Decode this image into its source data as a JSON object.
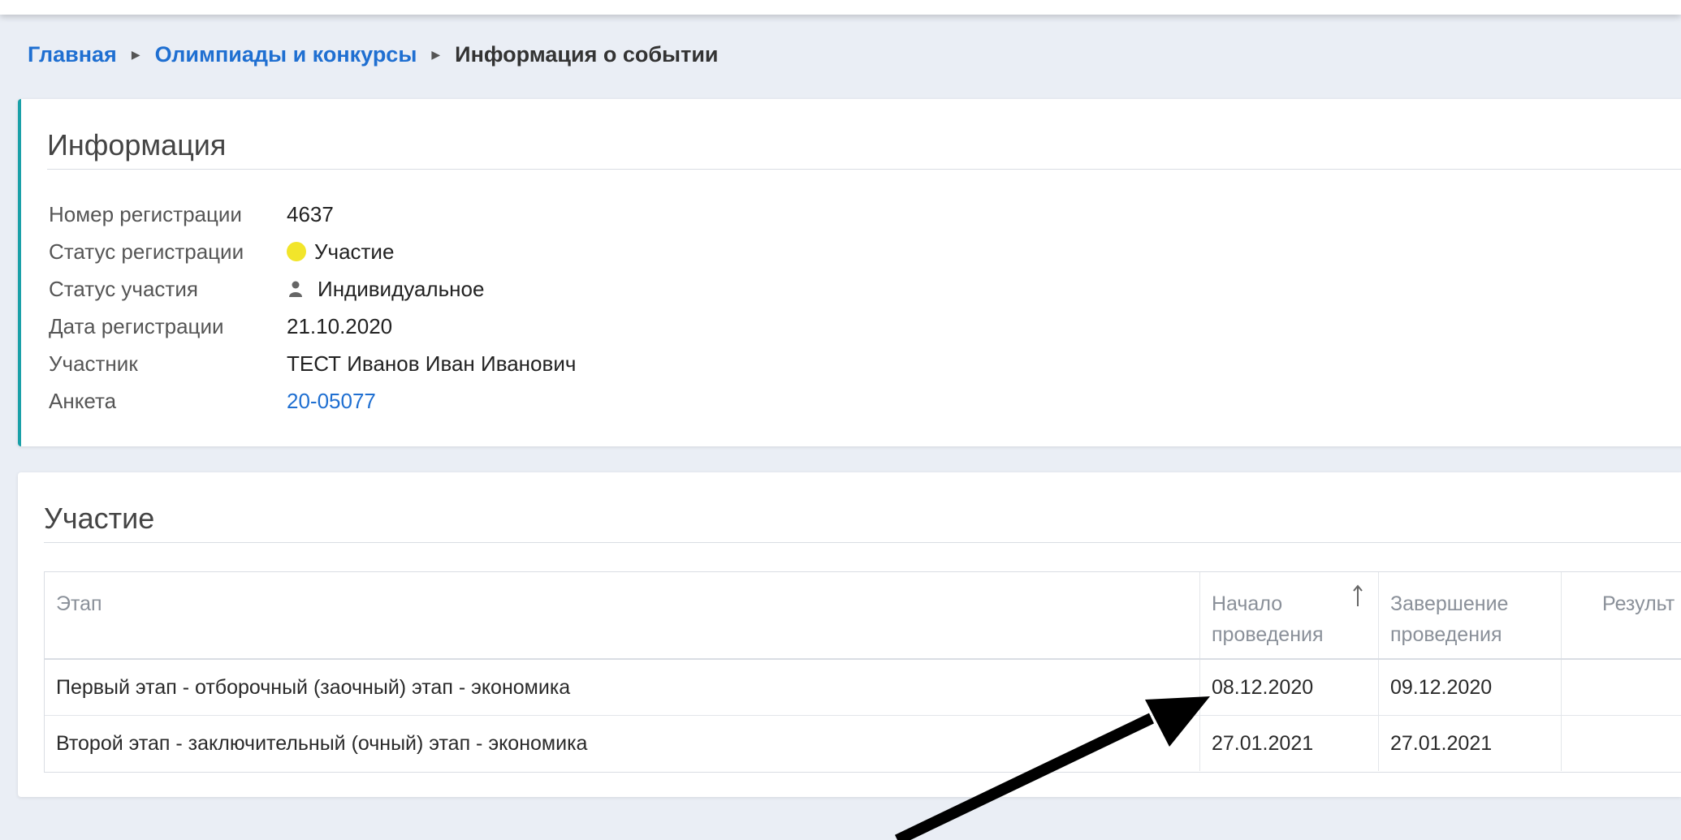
{
  "breadcrumb": {
    "home": "Главная",
    "olympiads": "Олимпиады и конкурсы",
    "current": "Информация о событии"
  },
  "info": {
    "title": "Информация",
    "rows": [
      {
        "label": "Номер регистрации",
        "value": "4637"
      },
      {
        "label": "Статус регистрации",
        "value": "Участие"
      },
      {
        "label": "Статус участия",
        "value": "Индивидуальное"
      },
      {
        "label": "Дата регистрации",
        "value": "21.10.2020"
      },
      {
        "label": "Участник",
        "value": "ТЕСТ Иванов Иван Иванович"
      },
      {
        "label": "Анкета",
        "value": "20-05077"
      }
    ],
    "status_dot_color": "#f2e52a"
  },
  "participation": {
    "title": "Участие",
    "columns": [
      "Этап",
      "Начало проведения",
      "Завершение проведения",
      "Результ"
    ],
    "rows": [
      {
        "stage": "Первый этап - отборочный (заочный) этап - экономика",
        "start": "08.12.2020",
        "end": "09.12.2020",
        "result": ""
      },
      {
        "stage": "Второй этап - заключительный (очный) этап - экономика",
        "start": "27.01.2021",
        "end": "27.01.2021",
        "result": ""
      }
    ]
  },
  "icons": {
    "breadcrumb_separator": "triangle-right-icon",
    "participation_status": "person-icon",
    "sort": "sort-asc-icon"
  },
  "colors": {
    "link": "#1f6fd1",
    "accent_border": "#1aa0a8",
    "background": "#eaeef5"
  }
}
